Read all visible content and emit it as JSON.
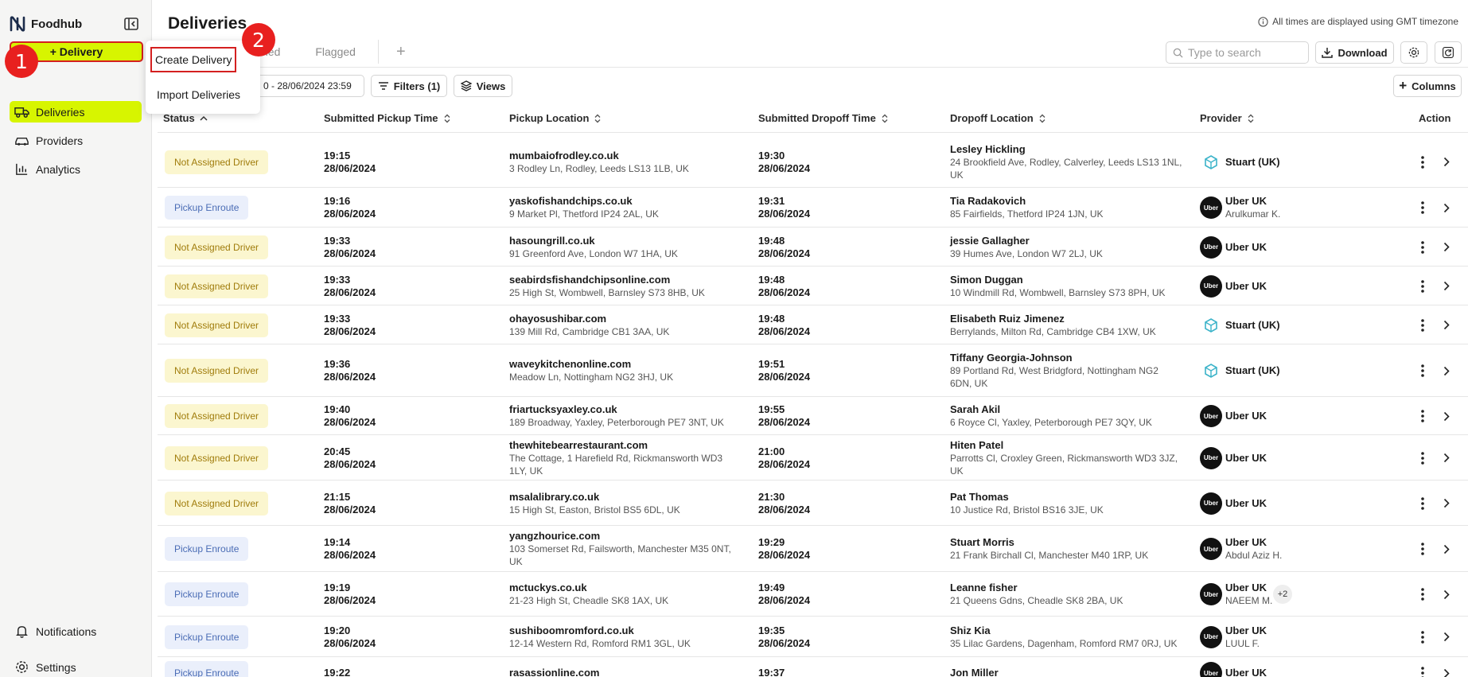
{
  "app": {
    "name": "Foodhub",
    "new_delivery_label": "+ Delivery"
  },
  "sidebar": {
    "items": [
      {
        "label": "Deliveries",
        "icon": "truck-icon",
        "active": true
      },
      {
        "label": "Providers",
        "icon": "car-icon",
        "active": false
      },
      {
        "label": "Analytics",
        "icon": "bar-chart-icon",
        "active": false
      }
    ],
    "bottom": [
      {
        "label": "Notifications",
        "icon": "bell-icon"
      },
      {
        "label": "Settings",
        "icon": "gear-icon"
      }
    ]
  },
  "markers": {
    "one": "1",
    "two": "2"
  },
  "header": {
    "title": "Deliveries",
    "timezone_note": "All times are displayed using GMT timezone",
    "tabs": [
      "ned",
      "Flagged"
    ],
    "search_placeholder": "Type to search",
    "download_label": "Download",
    "date_range": "0 - 28/06/2024 23:59",
    "filters_label": "Filters (1)",
    "views_label": "Views",
    "columns_label": "Columns"
  },
  "dropdown": {
    "items": [
      "Create Delivery",
      "Import Deliveries"
    ]
  },
  "table": {
    "columns": [
      "Status",
      "Submitted Pickup Time",
      "Pickup Location",
      "Submitted Dropoff Time",
      "Dropoff Location",
      "Provider",
      "Action"
    ],
    "rows": [
      {
        "status": "Not Assigned Driver",
        "kind": "na",
        "pt": "19:15",
        "pd": "28/06/2024",
        "pn": "mumbaiofrodley.co.uk",
        "pa": [
          "3 Rodley Ln, Rodley, Leeds LS13 1LB, UK"
        ],
        "dt": "19:30",
        "dd": "28/06/2024",
        "dn": "Lesley Hickling",
        "da": [
          "24 Brookfield Ave, Rodley, Calverley, Leeds LS13 1NL,",
          "UK"
        ],
        "prov": "Stuart (UK)",
        "ptype": "stuart",
        "driver": ""
      },
      {
        "status": "Pickup Enroute",
        "kind": "pe",
        "pt": "19:16",
        "pd": "28/06/2024",
        "pn": "yaskofishandchips.co.uk",
        "pa": [
          "9 Market Pl, Thetford IP24 2AL, UK"
        ],
        "dt": "19:31",
        "dd": "28/06/2024",
        "dn": "Tia Radakovich",
        "da": [
          "85 Fairfields, Thetford IP24 1JN, UK"
        ],
        "prov": "Uber UK",
        "ptype": "uber",
        "driver": "Arulkumar K."
      },
      {
        "status": "Not Assigned Driver",
        "kind": "na",
        "pt": "19:33",
        "pd": "28/06/2024",
        "pn": "hasoungrill.co.uk",
        "pa": [
          "91 Greenford Ave, London W7 1HA, UK"
        ],
        "dt": "19:48",
        "dd": "28/06/2024",
        "dn": "jessie Gallagher",
        "da": [
          "39 Humes Ave, London W7 2LJ, UK"
        ],
        "prov": "Uber UK",
        "ptype": "uber",
        "driver": ""
      },
      {
        "status": "Not Assigned Driver",
        "kind": "na",
        "pt": "19:33",
        "pd": "28/06/2024",
        "pn": "seabirdsfishandchipsonline.com",
        "pa": [
          "25 High St, Wombwell, Barnsley S73 8HB, UK"
        ],
        "dt": "19:48",
        "dd": "28/06/2024",
        "dn": "Simon Duggan",
        "da": [
          "10 Windmill Rd, Wombwell, Barnsley S73 8PH, UK"
        ],
        "prov": "Uber UK",
        "ptype": "uber",
        "driver": ""
      },
      {
        "status": "Not Assigned Driver",
        "kind": "na",
        "pt": "19:33",
        "pd": "28/06/2024",
        "pn": "ohayosushibar.com",
        "pa": [
          "139 Mill Rd, Cambridge CB1 3AA, UK"
        ],
        "dt": "19:48",
        "dd": "28/06/2024",
        "dn": "Elisabeth Ruiz Jimenez",
        "da": [
          "Berrylands, Milton Rd, Cambridge CB4 1XW, UK"
        ],
        "prov": "Stuart (UK)",
        "ptype": "stuart",
        "driver": ""
      },
      {
        "status": "Not Assigned Driver",
        "kind": "na",
        "pt": "19:36",
        "pd": "28/06/2024",
        "pn": "waveykitchenonline.com",
        "pa": [
          "Meadow Ln, Nottingham NG2 3HJ, UK"
        ],
        "dt": "19:51",
        "dd": "28/06/2024",
        "dn": "Tiffany Georgia-Johnson",
        "da": [
          "89 Portland Rd, West Bridgford, Nottingham NG2",
          "6DN, UK"
        ],
        "prov": "Stuart (UK)",
        "ptype": "stuart",
        "driver": ""
      },
      {
        "status": "Not Assigned Driver",
        "kind": "na",
        "pt": "19:40",
        "pd": "28/06/2024",
        "pn": "friartucksyaxley.co.uk",
        "pa": [
          "189 Broadway, Yaxley, Peterborough PE7 3NT, UK"
        ],
        "dt": "19:55",
        "dd": "28/06/2024",
        "dn": "Sarah Akil",
        "da": [
          "6 Royce Cl, Yaxley, Peterborough PE7 3QY, UK"
        ],
        "prov": "Uber UK",
        "ptype": "uber",
        "driver": ""
      },
      {
        "status": "Not Assigned Driver",
        "kind": "na",
        "pt": "20:45",
        "pd": "28/06/2024",
        "pn": "thewhitebearrestaurant.com",
        "pa": [
          "The Cottage, 1 Harefield Rd, Rickmansworth WD3",
          "1LY, UK"
        ],
        "dt": "21:00",
        "dd": "28/06/2024",
        "dn": "Hiten Patel",
        "da": [
          "Parrotts Cl, Croxley Green, Rickmansworth WD3 3JZ,",
          "UK"
        ],
        "prov": "Uber UK",
        "ptype": "uber",
        "driver": ""
      },
      {
        "status": "Not Assigned Driver",
        "kind": "na",
        "pt": "21:15",
        "pd": "28/06/2024",
        "pn": "msalalibrary.co.uk",
        "pa": [
          "15 High St, Easton, Bristol BS5 6DL, UK"
        ],
        "dt": "21:30",
        "dd": "28/06/2024",
        "dn": "Pat Thomas",
        "da": [
          "10 Justice Rd, Bristol BS16 3JE, UK"
        ],
        "prov": "Uber UK",
        "ptype": "uber",
        "driver": ""
      },
      {
        "status": "Pickup Enroute",
        "kind": "pe",
        "pt": "19:14",
        "pd": "28/06/2024",
        "pn": "yangzhourice.com",
        "pa": [
          "103 Somerset Rd, Failsworth, Manchester M35 0NT,",
          "UK"
        ],
        "dt": "19:29",
        "dd": "28/06/2024",
        "dn": "Stuart Morris",
        "da": [
          "21 Frank Birchall Cl, Manchester M40 1RP, UK"
        ],
        "prov": "Uber UK",
        "ptype": "uber",
        "driver": "Abdul Aziz H."
      },
      {
        "status": "Pickup Enroute",
        "kind": "pe",
        "pt": "19:19",
        "pd": "28/06/2024",
        "pn": "mctuckys.co.uk",
        "pa": [
          "21-23 High St, Cheadle SK8 1AX, UK"
        ],
        "dt": "19:49",
        "dd": "28/06/2024",
        "dn": "Leanne fisher",
        "da": [
          "21 Queens Gdns, Cheadle SK8 2BA, UK"
        ],
        "prov": "Uber UK",
        "ptype": "uber",
        "driver": "NAEEM M.",
        "extra": "+2"
      },
      {
        "status": "Pickup Enroute",
        "kind": "pe",
        "pt": "19:20",
        "pd": "28/06/2024",
        "pn": "sushiboomromford.co.uk",
        "pa": [
          "12-14 Western Rd, Romford RM1 3GL, UK"
        ],
        "dt": "19:35",
        "dd": "28/06/2024",
        "dn": "Shiz Kia",
        "da": [
          "35 Lilac Gardens, Dagenham, Romford RM7 0RJ, UK"
        ],
        "prov": "Uber UK",
        "ptype": "uber",
        "driver": "LUUL F."
      },
      {
        "status": "Pickup Enroute",
        "kind": "pe",
        "pt": "19:22",
        "pd": "",
        "pn": "rasassionline.com",
        "pa": [],
        "dt": "19:37",
        "dd": "",
        "dn": "Jon Miller",
        "da": [],
        "prov": "Uber UK",
        "ptype": "uber",
        "driver": ""
      }
    ]
  },
  "uber_logo_text": "Uber",
  "colors": {
    "accent": "#d7f500",
    "marker": "#e8201f",
    "highlight_border": "#d42020",
    "na_bg": "#fbf6cf",
    "pe_bg": "#eaeffb"
  }
}
